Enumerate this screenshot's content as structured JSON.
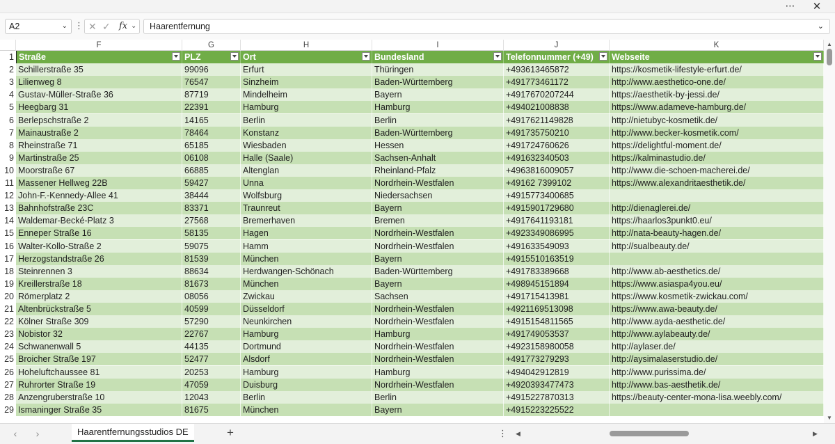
{
  "window": {
    "more_icon": "more-horizontal-icon",
    "close_icon": "close-icon"
  },
  "formula_bar": {
    "name_box": "A2",
    "formula": "Haarentfernung"
  },
  "columns": [
    "F",
    "G",
    "H",
    "I",
    "J",
    "K"
  ],
  "header": {
    "row": "1",
    "cells": [
      "Straße",
      "PLZ",
      "Ort",
      "Bundesland",
      "Telefonnummer (+49)",
      "Webseite"
    ]
  },
  "rows": [
    {
      "n": "2",
      "c": [
        "Schillerstraße 35",
        "99096",
        "Erfurt",
        "Thüringen",
        "+493613465872",
        "https://kosmetik-lifestyle-erfurt.de/"
      ]
    },
    {
      "n": "3",
      "c": [
        "Lilienweg 8",
        "76547",
        "Sinzheim",
        "Baden-Württemberg",
        "+491773461172",
        "http://www.aesthetico-one.de/"
      ]
    },
    {
      "n": "4",
      "c": [
        "Gustav-Müller-Straße 36",
        "87719",
        "Mindelheim",
        "Bayern",
        "+4917670207244",
        "https://aesthetik-by-jessi.de/"
      ]
    },
    {
      "n": "5",
      "c": [
        "Heegbarg 31",
        "22391",
        "Hamburg",
        "Hamburg",
        "+494021008838",
        "https://www.adameve-hamburg.de/"
      ]
    },
    {
      "n": "6",
      "c": [
        "Berlepschstraße 2",
        "14165",
        "Berlin",
        "Berlin",
        "+4917621149828",
        "http://nietubyc-kosmetik.de/"
      ]
    },
    {
      "n": "7",
      "c": [
        "Mainaustraße 2",
        "78464",
        "Konstanz",
        "Baden-Württemberg",
        "+491735750210",
        "http://www.becker-kosmetik.com/"
      ]
    },
    {
      "n": "8",
      "c": [
        "Rheinstraße 71",
        "65185",
        "Wiesbaden",
        "Hessen",
        "+491724760626",
        "https://delightful-moment.de/"
      ]
    },
    {
      "n": "9",
      "c": [
        "Martinstraße 25",
        "06108",
        "Halle (Saale)",
        "Sachsen-Anhalt",
        "+491632340503",
        "https://kalminastudio.de/"
      ]
    },
    {
      "n": "10",
      "c": [
        "Moorstraße 67",
        "66885",
        "Altenglan",
        "Rheinland-Pfalz",
        "+4963816009057",
        "http://www.die-schoen-macherei.de/"
      ]
    },
    {
      "n": "11",
      "c": [
        "Massener Hellweg 22B",
        "59427",
        "Unna",
        "Nordrhein-Westfalen",
        "+49162 7399102",
        "https://www.alexandritaesthetik.de/"
      ]
    },
    {
      "n": "12",
      "c": [
        "John-F.-Kennedy-Allee 41",
        "38444",
        "Wolfsburg",
        "Niedersachsen",
        "+4915773400685",
        ""
      ]
    },
    {
      "n": "13",
      "c": [
        "Bahnhofstraße 23C",
        "83371",
        "Traunreut",
        "Bayern",
        "+4915901729680",
        "http://dienaglerei.de/"
      ]
    },
    {
      "n": "14",
      "c": [
        "Waldemar-Becké-Platz 3",
        "27568",
        "Bremerhaven",
        "Bremen",
        "+4917641193181",
        "https://haarlos3punkt0.eu/"
      ]
    },
    {
      "n": "15",
      "c": [
        "Enneper Straße 16",
        "58135",
        "Hagen",
        "Nordrhein-Westfalen",
        "+4923349086995",
        "http://nata-beauty-hagen.de/"
      ]
    },
    {
      "n": "16",
      "c": [
        "Walter-Kollo-Straße 2",
        "59075",
        "Hamm",
        "Nordrhein-Westfalen",
        "+491633549093",
        "http://sualbeauty.de/"
      ]
    },
    {
      "n": "17",
      "c": [
        "Herzogstandstraße 26",
        "81539",
        "München",
        "Bayern",
        "+4915510163519",
        ""
      ]
    },
    {
      "n": "18",
      "c": [
        "Steinrennen 3",
        "88634",
        "Herdwangen-Schönach",
        "Baden-Württemberg",
        "+491783389668",
        "http://www.ab-aesthetics.de/"
      ]
    },
    {
      "n": "19",
      "c": [
        "Kreillerstraße 18",
        "81673",
        "München",
        "Bayern",
        "+498945151894",
        "https://www.asiaspa4you.eu/"
      ]
    },
    {
      "n": "20",
      "c": [
        "Römerplatz 2",
        "08056",
        "Zwickau",
        "Sachsen",
        "+491715413981",
        "https://www.kosmetik-zwickau.com/"
      ]
    },
    {
      "n": "21",
      "c": [
        "Altenbrückstraße 5",
        "40599",
        "Düsseldorf",
        "Nordrhein-Westfalen",
        "+4921169513098",
        "https://www.awa-beauty.de/"
      ]
    },
    {
      "n": "22",
      "c": [
        "Kölner Straße 309",
        "57290",
        "Neunkirchen",
        "Nordrhein-Westfalen",
        "+4915154811565",
        "http://www.ayda-aesthetic.de/"
      ]
    },
    {
      "n": "23",
      "c": [
        "Nobistor 32",
        "22767",
        "Hamburg",
        "Hamburg",
        "+491749053537",
        "http://www.aylabeauty.de/"
      ]
    },
    {
      "n": "24",
      "c": [
        "Schwanenwall 5",
        "44135",
        "Dortmund",
        "Nordrhein-Westfalen",
        "+4923158980058",
        "http://aylaser.de/"
      ]
    },
    {
      "n": "25",
      "c": [
        "Broicher Straße 197",
        "52477",
        "Alsdorf",
        "Nordrhein-Westfalen",
        "+491773279293",
        "http://aysimalaserstudio.de/"
      ]
    },
    {
      "n": "26",
      "c": [
        "Hoheluftchaussee 81",
        "20253",
        "Hamburg",
        "Hamburg",
        "+494042912819",
        "http://www.purissima.de/"
      ]
    },
    {
      "n": "27",
      "c": [
        "Ruhrorter Straße 19",
        "47059",
        "Duisburg",
        "Nordrhein-Westfalen",
        "+4920393477473",
        "http://www.bas-aesthetik.de/"
      ]
    },
    {
      "n": "28",
      "c": [
        "Anzengruberstraße 10",
        "12043",
        "Berlin",
        "Berlin",
        "+4915227870313",
        "https://beauty-center-mona-lisa.weebly.com/"
      ]
    },
    {
      "n": "29",
      "c": [
        "Ismaninger Straße 35",
        "81675",
        "München",
        "Bayern",
        "+4915223225522",
        ""
      ]
    }
  ],
  "sheet": {
    "tab_label": "Haarentfernungsstudios DE",
    "add_label": "+"
  },
  "colors": {
    "header_fill": "#70ad47",
    "band_light": "#e2efda",
    "band_dark": "#c6e0b4"
  }
}
